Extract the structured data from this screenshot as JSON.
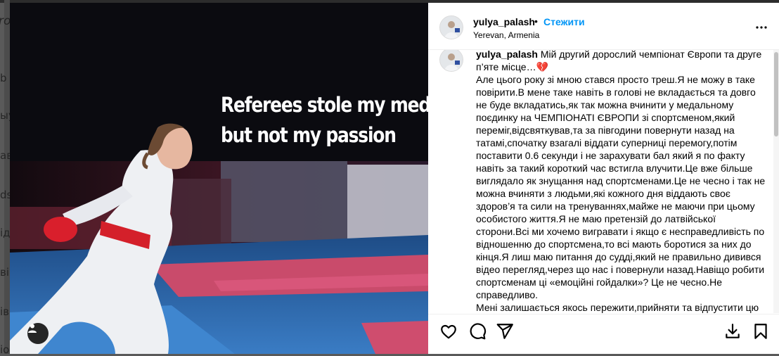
{
  "header": {
    "username": "yulya_palash",
    "dot": "•",
    "follow_label": "Стежити",
    "location": "Yerevan, Armenia"
  },
  "media": {
    "headline_line1": "Referees stole my medal",
    "headline_line2": "but not my passion"
  },
  "caption": {
    "username": "yulya_palash",
    "text_line1": " Мій другий дорослий чемпіонат Європи та друге п’яте місце…💔",
    "body": "Але цього року зі мною стався просто треш.Я не можу в таке повірити.В мене таке навіть в голові не вкладається та довго не буде вкладатись,як так можна вчинити у медальному поєдинку на ЧЕМПІОНАТІ ЄВРОПИ зі спортсменом,який переміг,відсвяткував,та за півгодини повернути назад на татамі,спочатку взагалі віддати суперниці перемогу,потім поставити 0.6 секунди і не зарахувати бал який я по факту навіть за такий короткий час встигла влучити.Це вже більше виглядало як знущання над спортсменами.Це не чесно і так не можна вчиняти з людьми,які кожного дня віддають своє здоров’я та сили на тренуваннях,майже не маючи при цьому особистого життя.Я не маю претензій до латвійської сторони.Всі ми хочемо вигравати і якщо є несправедливість по відношенню до спортсмена,то всі мають боротися за них до кінця.Я лиш маю питання до судді,який не правильно дивився відео перегляд,через що нас і повернули назад.Навіщо робити спортсменам ці «емоційні гойдалки»? Це не чесно.Не справедливо.",
    "body_last": "Мені залишається якось пережити,прийняти та відпустити цю"
  },
  "actions": {
    "like_icon": "heart-icon",
    "comment_icon": "comment-icon",
    "share_icon": "share-icon",
    "download_icon": "download-icon",
    "save_icon": "bookmark-icon"
  },
  "background_letters": [
    "ro",
    "b",
    "ыу",
    "ав",
    "ds",
    "ід",
    "ві",
    "ів",
    "іо"
  ],
  "colors": {
    "accent": "#0095f6",
    "belt": "#d4202a",
    "backdrop": "#5a5a5a"
  }
}
